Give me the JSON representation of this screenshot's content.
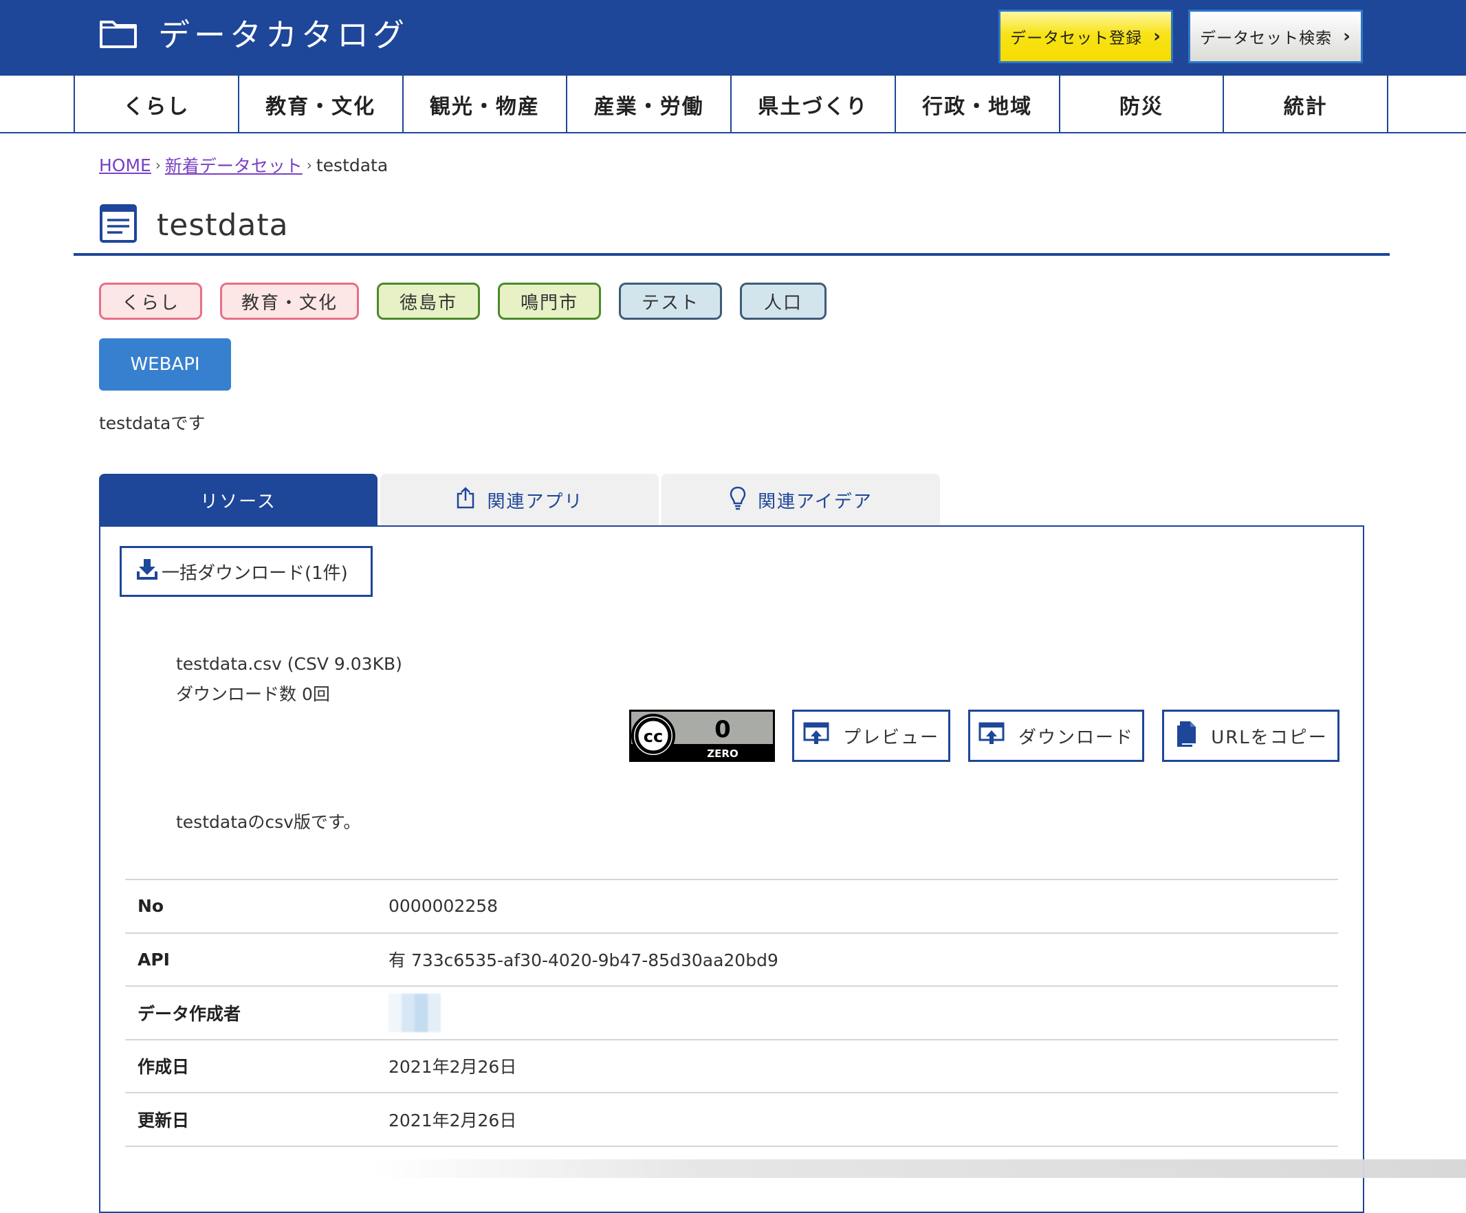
{
  "header": {
    "title": "データカタログ",
    "register_button": "データセット登録",
    "search_button": "データセット検索",
    "chevron": "›"
  },
  "global_nav": [
    "くらし",
    "教育・文化",
    "観光・物産",
    "産業・労働",
    "県土づくり",
    "行政・地域",
    "防災",
    "統計"
  ],
  "breadcrumb": {
    "home": "HOME",
    "new_datasets": "新着データセット",
    "current": "testdata",
    "separator": "›"
  },
  "dataset": {
    "title": "testdata",
    "tags": [
      {
        "label": "くらし",
        "color": "pink"
      },
      {
        "label": "教育・文化",
        "color": "pink"
      },
      {
        "label": "徳島市",
        "color": "green"
      },
      {
        "label": "鳴門市",
        "color": "green"
      },
      {
        "label": "テスト",
        "color": "blue"
      },
      {
        "label": "人口",
        "color": "blue"
      }
    ],
    "api_badge": "WEBAPI",
    "description": "testdataです"
  },
  "tabs": {
    "resources": "リソース",
    "related_apps": "関連アプリ",
    "related_ideas": "関連アイデア"
  },
  "resource_panel": {
    "bulk_download": "一括ダウンロード(1件)",
    "file_label": "testdata.csv (CSV 9.03KB)",
    "download_count": "ダウンロード数 0回",
    "license": {
      "cc": "cc",
      "zero_digit": "0",
      "zero_text": "ZERO"
    },
    "preview_button": "プレビュー",
    "download_button": "ダウンロード",
    "copy_url_button": "URLをコピー",
    "resource_description": "testdataのcsv版です。"
  },
  "meta": [
    {
      "label": "No",
      "value": "0000002258"
    },
    {
      "label": "API",
      "value": "有 733c6535-af30-4020-9b47-85d30aa20bd9"
    },
    {
      "label": "データ作成者",
      "value": ""
    },
    {
      "label": "作成日",
      "value": "2021年2月26日"
    },
    {
      "label": "更新日",
      "value": "2021年2月26日"
    }
  ],
  "colors": {
    "brand_navy": "#1e4699",
    "register_yellow": "#f5dc00",
    "webapi_blue": "#3680cf",
    "link_purple": "#7b3fc4"
  },
  "icons": [
    "folder-icon",
    "document-list-icon",
    "share-icon",
    "lightbulb-icon",
    "download-tray-icon",
    "cc0-license-icon",
    "preview-icon",
    "file-icon"
  ]
}
